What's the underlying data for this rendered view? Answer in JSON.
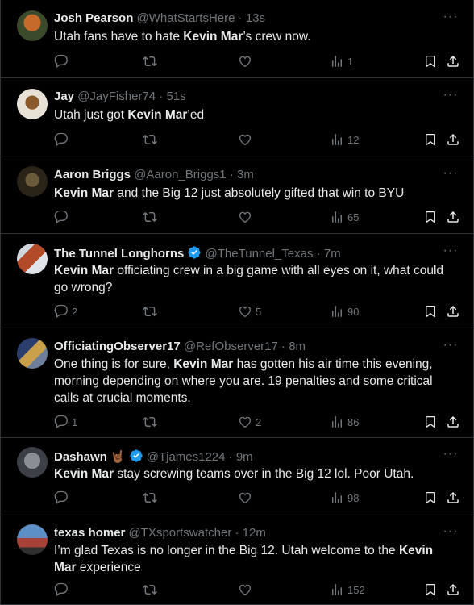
{
  "tweets": [
    {
      "name": "Josh Pearson",
      "handle": "@WhatStartsHere",
      "time": "13s",
      "emoji": "",
      "text": [
        {
          "t": "Utah fans have to hate "
        },
        {
          "t": "Kevin Mar",
          "b": true
        },
        {
          "t": "’s crew now."
        }
      ],
      "replies": "",
      "retweets": "",
      "likes": "",
      "views": "1"
    },
    {
      "name": "Jay",
      "handle": "@JayFisher74",
      "time": "51s",
      "emoji": "",
      "text": [
        {
          "t": "Utah just got "
        },
        {
          "t": "Kevin Mar",
          "b": true
        },
        {
          "t": "’ed"
        }
      ],
      "replies": "",
      "retweets": "",
      "likes": "",
      "views": "12"
    },
    {
      "name": "Aaron Briggs",
      "handle": "@Aaron_Briggs1",
      "time": "3m",
      "emoji": "",
      "text": [
        {
          "t": "Kevin Mar",
          "b": true
        },
        {
          "t": " and the Big 12 just absolutely gifted that win to BYU"
        }
      ],
      "replies": "",
      "retweets": "",
      "likes": "",
      "views": "65"
    },
    {
      "name": "The Tunnel Longhorns",
      "handle": "@TheTunnel_Texas",
      "time": "7m",
      "emoji": "",
      "verified": true,
      "text": [
        {
          "t": "Kevin Mar",
          "b": true
        },
        {
          "t": " officiating crew in a big game with all eyes on it, what could go wrong?"
        }
      ],
      "replies": "2",
      "retweets": "",
      "likes": "5",
      "views": "90"
    },
    {
      "name": "OfficiatingObserver17",
      "handle": "@RefObserver17",
      "time": "8m",
      "emoji": "",
      "text": [
        {
          "t": "One thing is for sure, "
        },
        {
          "t": "Kevin Mar",
          "b": true
        },
        {
          "t": " has gotten his air time this evening, morning depending on where you are. 19 penalties and some critical calls at crucial moments."
        }
      ],
      "replies": "1",
      "retweets": "",
      "likes": "2",
      "views": "86"
    },
    {
      "name": "Dashawn",
      "handle": "@Tjames1224",
      "time": "9m",
      "emoji": "🤘🏾",
      "verified": true,
      "text": [
        {
          "t": "Kevin Mar",
          "b": true
        },
        {
          "t": " stay screwing teams over in the Big 12 lol. Poor Utah."
        }
      ],
      "replies": "",
      "retweets": "",
      "likes": "",
      "views": "98"
    },
    {
      "name": "texas homer",
      "handle": "@TXsportswatcher",
      "time": "12m",
      "emoji": "",
      "text": [
        {
          "t": "I’m glad Texas is no longer in the Big 12. Utah welcome to the "
        },
        {
          "t": "Kevin Mar",
          "b": true
        },
        {
          "t": " experience"
        }
      ],
      "replies": "",
      "retweets": "",
      "likes": "",
      "views": "152"
    }
  ],
  "icons": {
    "reply": "reply-icon",
    "retweet": "retweet-icon",
    "like": "heart-icon",
    "views": "views-icon",
    "bookmark": "bookmark-icon",
    "share": "share-icon",
    "more": "more-icon",
    "verified": "verified-badge-icon"
  },
  "colors": {
    "background": "#000000",
    "text": "#e7e9ea",
    "muted": "#71767b",
    "divider": "#2f3336",
    "verified": "#1d9bf0"
  }
}
